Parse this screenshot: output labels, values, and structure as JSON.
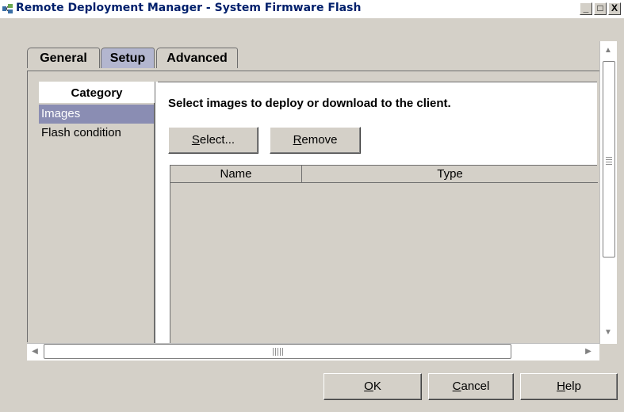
{
  "window": {
    "title": "Remote Deployment Manager - System Firmware Flash",
    "icon": "rdm-app-icon",
    "controls": {
      "minimize": "_",
      "maximize": "□",
      "close": "X"
    }
  },
  "tabs": [
    {
      "label": "General",
      "active": false
    },
    {
      "label": "Setup",
      "active": true
    },
    {
      "label": "Advanced",
      "active": false
    }
  ],
  "category": {
    "header": "Category",
    "items": [
      {
        "label": "Images",
        "selected": true
      },
      {
        "label": "Flash condition",
        "selected": false
      }
    ]
  },
  "main": {
    "instruction": "Select images to deploy or download to the client.",
    "select_button": {
      "mnemonic": "S",
      "rest": "elect..."
    },
    "remove_button": {
      "mnemonic": "R",
      "rest": "emove"
    },
    "table": {
      "columns": [
        "Name",
        "Type"
      ],
      "rows": []
    }
  },
  "footer": {
    "ok": {
      "mnemonic": "O",
      "rest": "K"
    },
    "cancel": {
      "mnemonic": "C",
      "rest": "ancel"
    },
    "help": {
      "mnemonic": "H",
      "rest": "elp"
    }
  },
  "icons": {
    "scroll_up": "arrow-up-icon",
    "scroll_down": "arrow-down-icon",
    "scroll_left": "arrow-left-icon",
    "scroll_right": "arrow-right-icon"
  },
  "colors": {
    "title_text": "#001f6b",
    "selected_bg": "#8a8db3",
    "active_tab": "#b3b6cf",
    "face": "#d4d0c8"
  }
}
